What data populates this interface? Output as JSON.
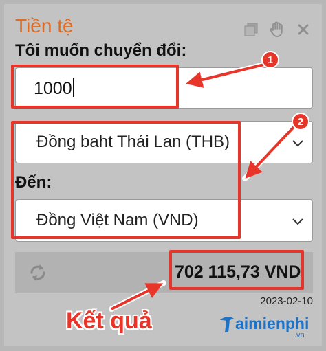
{
  "widget": {
    "title": "Tiền tệ",
    "subtitle": "Tôi muốn chuyển đổi:",
    "header_icons": [
      "copy-icon",
      "hand-drag-icon",
      "close-icon"
    ],
    "title_color": "#e06a1f"
  },
  "converter": {
    "amount_value": "1000",
    "from_currency": "Đồng baht Thái Lan (THB)",
    "to_label": "Đến:",
    "to_currency": "Đồng Việt Nam (VND)",
    "result": "702 115,73 VND",
    "date": "2023-02-10"
  },
  "annotations": {
    "badge_1": "1",
    "badge_2": "2",
    "result_label": "Kết quả",
    "highlight_color": "#e8352a"
  },
  "watermark": {
    "brand": "aimienphi",
    "suffix": ".vn"
  }
}
